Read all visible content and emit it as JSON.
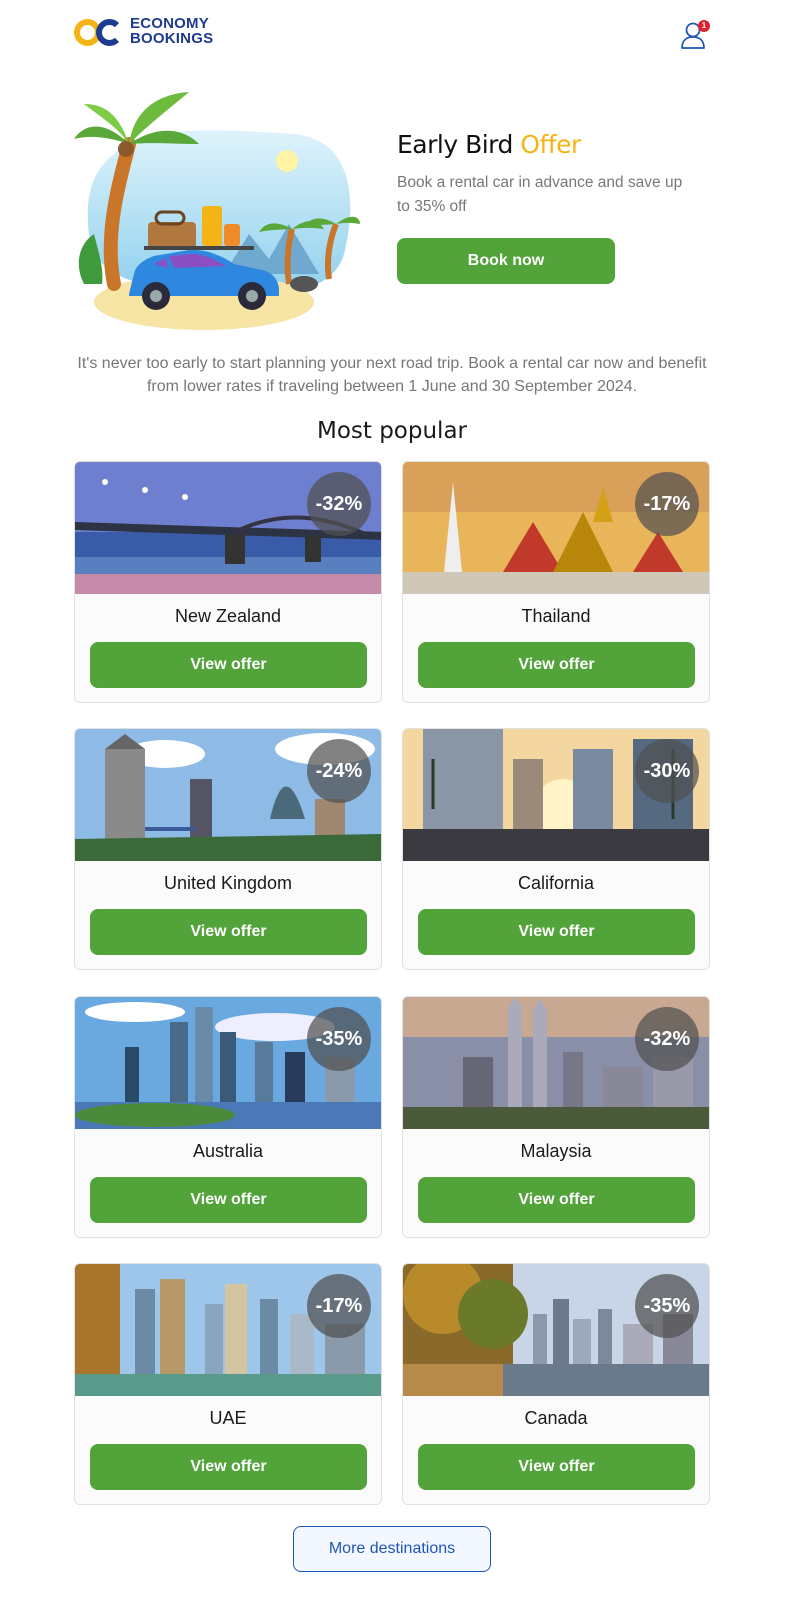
{
  "header": {
    "logo_line1": "ECONOMY",
    "logo_line2": "BOOKINGS",
    "account_badge": "1",
    "account_icon": "user-icon"
  },
  "hero": {
    "title_main": "Early Bird ",
    "title_accent": "Offer",
    "subtitle": "Book a rental car in advance and save up to 35% off",
    "button_label": "Book now",
    "accent_color": "#f5b415",
    "button_color": "#52a33a"
  },
  "intro_text": "It's never too early to start planning your next road trip. Book a rental car now and benefit from lower rates if traveling between 1 June and 30 September 2024.",
  "section_title": "Most popular",
  "destinations": [
    {
      "name": "New Zealand",
      "discount": "-32%",
      "button": "View offer"
    },
    {
      "name": "Thailand",
      "discount": "-17%",
      "button": "View offer"
    },
    {
      "name": "United Kingdom",
      "discount": "-24%",
      "button": "View offer"
    },
    {
      "name": "California",
      "discount": "-30%",
      "button": "View offer"
    },
    {
      "name": "Australia",
      "discount": "-35%",
      "button": "View offer"
    },
    {
      "name": "Malaysia",
      "discount": "-32%",
      "button": "View offer"
    },
    {
      "name": "UAE",
      "discount": "-17%",
      "button": "View offer"
    },
    {
      "name": "Canada",
      "discount": "-35%",
      "button": "View offer"
    }
  ],
  "more_button": "More destinations"
}
